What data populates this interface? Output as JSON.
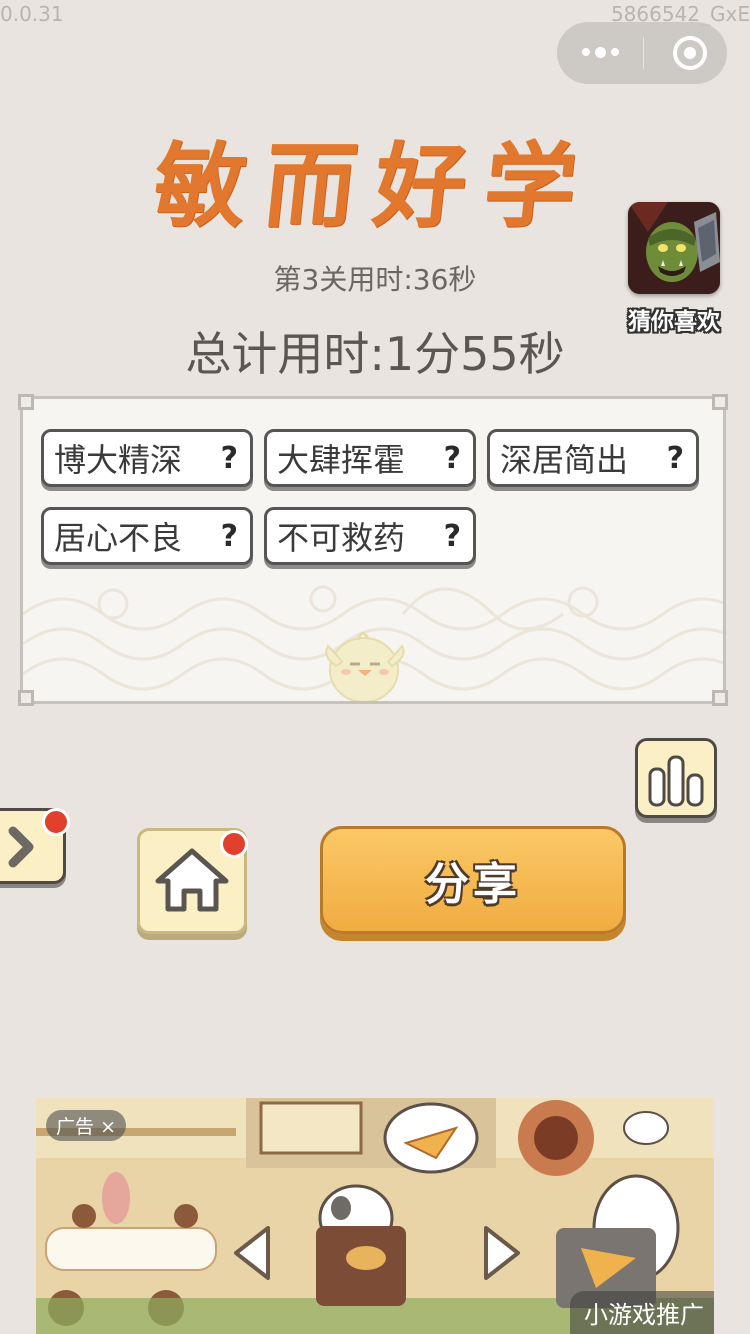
{
  "status": {
    "version": "0.0.31",
    "build": "5866542_GxE"
  },
  "title": "敏而好学",
  "stats": {
    "level_time": "第3关用时:36秒",
    "total_time": "总计用时:1分55秒"
  },
  "recommend": {
    "label": "猜你喜欢",
    "icon": "orc-warrior-game-icon"
  },
  "idioms": [
    {
      "text": "博大精深",
      "help": "?"
    },
    {
      "text": "大肆挥霍",
      "help": "?"
    },
    {
      "text": "深居简出",
      "help": "?"
    },
    {
      "text": "居心不良",
      "help": "?"
    },
    {
      "text": "不可救药",
      "help": "?"
    }
  ],
  "buttons": {
    "share": "分享"
  },
  "ad": {
    "tag": "广告",
    "close": "×",
    "cta": "小游戏推广"
  },
  "colors": {
    "title": "#e2782e",
    "share": "#f0ac41",
    "background": "#e9e4df",
    "badge": "#e0402c"
  }
}
